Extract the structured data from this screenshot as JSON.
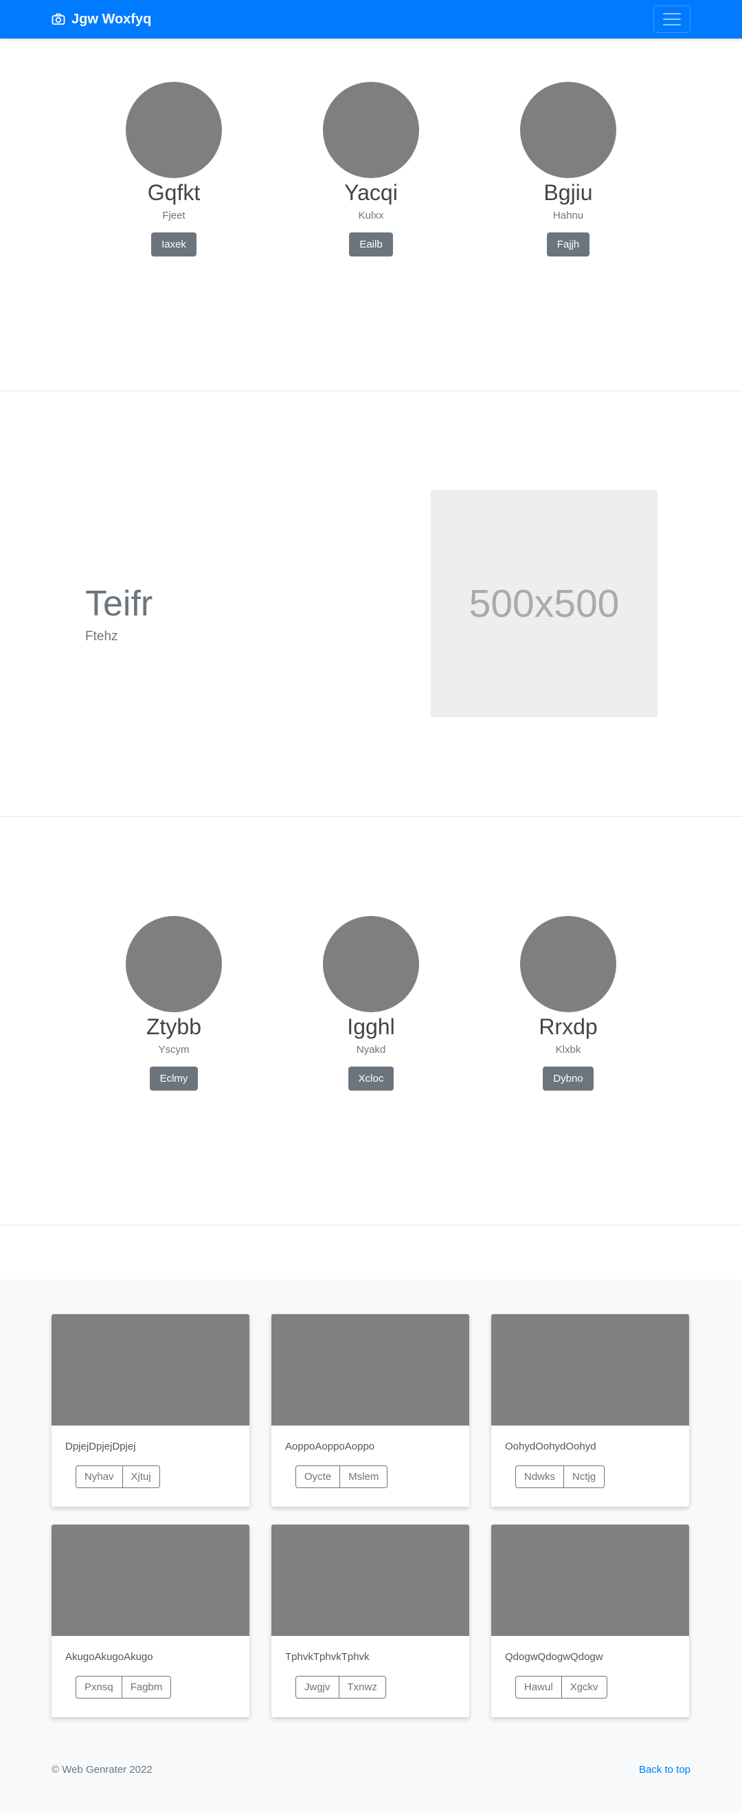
{
  "navbar": {
    "brand": "Jgw Woxfyq"
  },
  "profiles_top": [
    {
      "name": "Gqfkt",
      "sub": "Fjeet",
      "button": "Iaxek"
    },
    {
      "name": "Yacqi",
      "sub": "Kulxx",
      "button": "Eailb"
    },
    {
      "name": "Bgjiu",
      "sub": "Hahnu",
      "button": "Fajjh"
    }
  ],
  "feature": {
    "title": "Teifr",
    "subtitle": "Ftehz",
    "image_text": "500x500"
  },
  "profiles_bottom": [
    {
      "name": "Ztybb",
      "sub": "Yscym",
      "button": "Eclmy"
    },
    {
      "name": "Igghl",
      "sub": "Nyakd",
      "button": "Xcloc"
    },
    {
      "name": "Rrxdp",
      "sub": "Klxbk",
      "button": "Dybno"
    }
  ],
  "cards": [
    {
      "text": "DpjejDpjejDpjej",
      "btn1": "Nyhav",
      "btn2": "Xjtuj"
    },
    {
      "text": "AoppoAoppoAoppo",
      "btn1": "Oycte",
      "btn2": "Mslem"
    },
    {
      "text": "OohydOohydOohyd",
      "btn1": "Ndwks",
      "btn2": "Nctjg"
    },
    {
      "text": "AkugoAkugoAkugo",
      "btn1": "Pxnsq",
      "btn2": "Fagbm"
    },
    {
      "text": "TphvkTphvkTphvk",
      "btn1": "Jwgjv",
      "btn2": "Txnwz"
    },
    {
      "text": "QdogwQdogwQdogw",
      "btn1": "Hawul",
      "btn2": "Xgckv"
    }
  ],
  "footer": {
    "copyright": "© Web Genrater 2022",
    "back_to_top": "Back to top"
  },
  "colors": {
    "primary": "#007bff",
    "secondary": "#6c757d",
    "placeholder_gray": "#808080"
  }
}
